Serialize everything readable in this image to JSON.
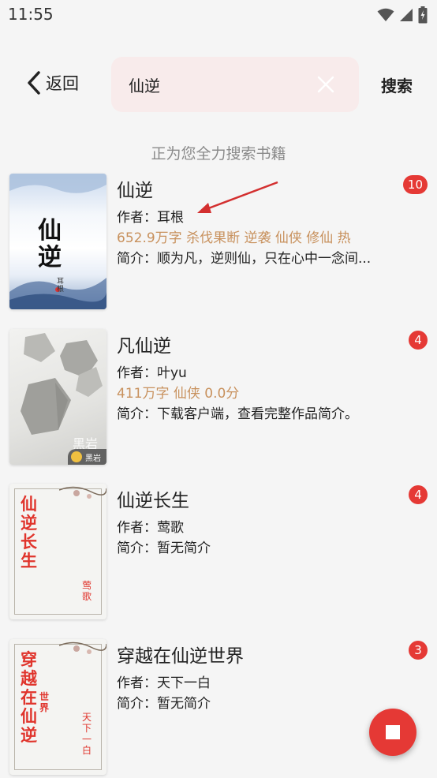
{
  "status_bar": {
    "time": "11:55"
  },
  "header": {
    "back_label": "返回",
    "search_value": "仙逆",
    "search_button": "搜索"
  },
  "searching_text": "正为您全力搜索书籍",
  "books": [
    {
      "title": "仙逆",
      "author": "作者：耳根",
      "tags": "652.9万字  杀伐果断  逆袭  仙侠  修仙  热",
      "intro": "简介：顺为凡，逆则仙，只在心中一念间...",
      "badge": "10",
      "cover_text": "仙逆",
      "cover_author": "耳根"
    },
    {
      "title": "凡仙逆",
      "author": "作者：叶yu",
      "tags": "411万字  仙侠  0.0分",
      "intro": "简介：下载客户端，查看完整作品简介。",
      "badge": "4",
      "cover_text": "黑岩",
      "cover_brand": "黑岩"
    },
    {
      "title": "仙逆长生",
      "author": "作者：莺歌",
      "intro": "简介：暂无简介",
      "badge": "4",
      "cover_title_chars": [
        "仙",
        "逆",
        "长",
        "生"
      ],
      "cover_author_chars": [
        "莺",
        "歌"
      ]
    },
    {
      "title": "穿越在仙逆世界",
      "author": "作者：天下一白",
      "intro": "简介：暂无简介",
      "badge": "3",
      "cover_title_chars": [
        "穿",
        "越",
        "在",
        "仙",
        "逆"
      ],
      "cover_sub_chars": [
        "世",
        "界"
      ],
      "cover_author_chars": [
        "天",
        "下",
        "一",
        "白"
      ]
    }
  ],
  "colors": {
    "accent": "#e53935",
    "tag": "#c8915d",
    "search_bg": "#f8ebeb",
    "page_bg": "#f5f5f5"
  },
  "icons": [
    "wifi-icon",
    "signal-icon",
    "battery-icon",
    "back-arrow-icon",
    "clear-icon",
    "stop-icon",
    "annotation-arrow"
  ]
}
